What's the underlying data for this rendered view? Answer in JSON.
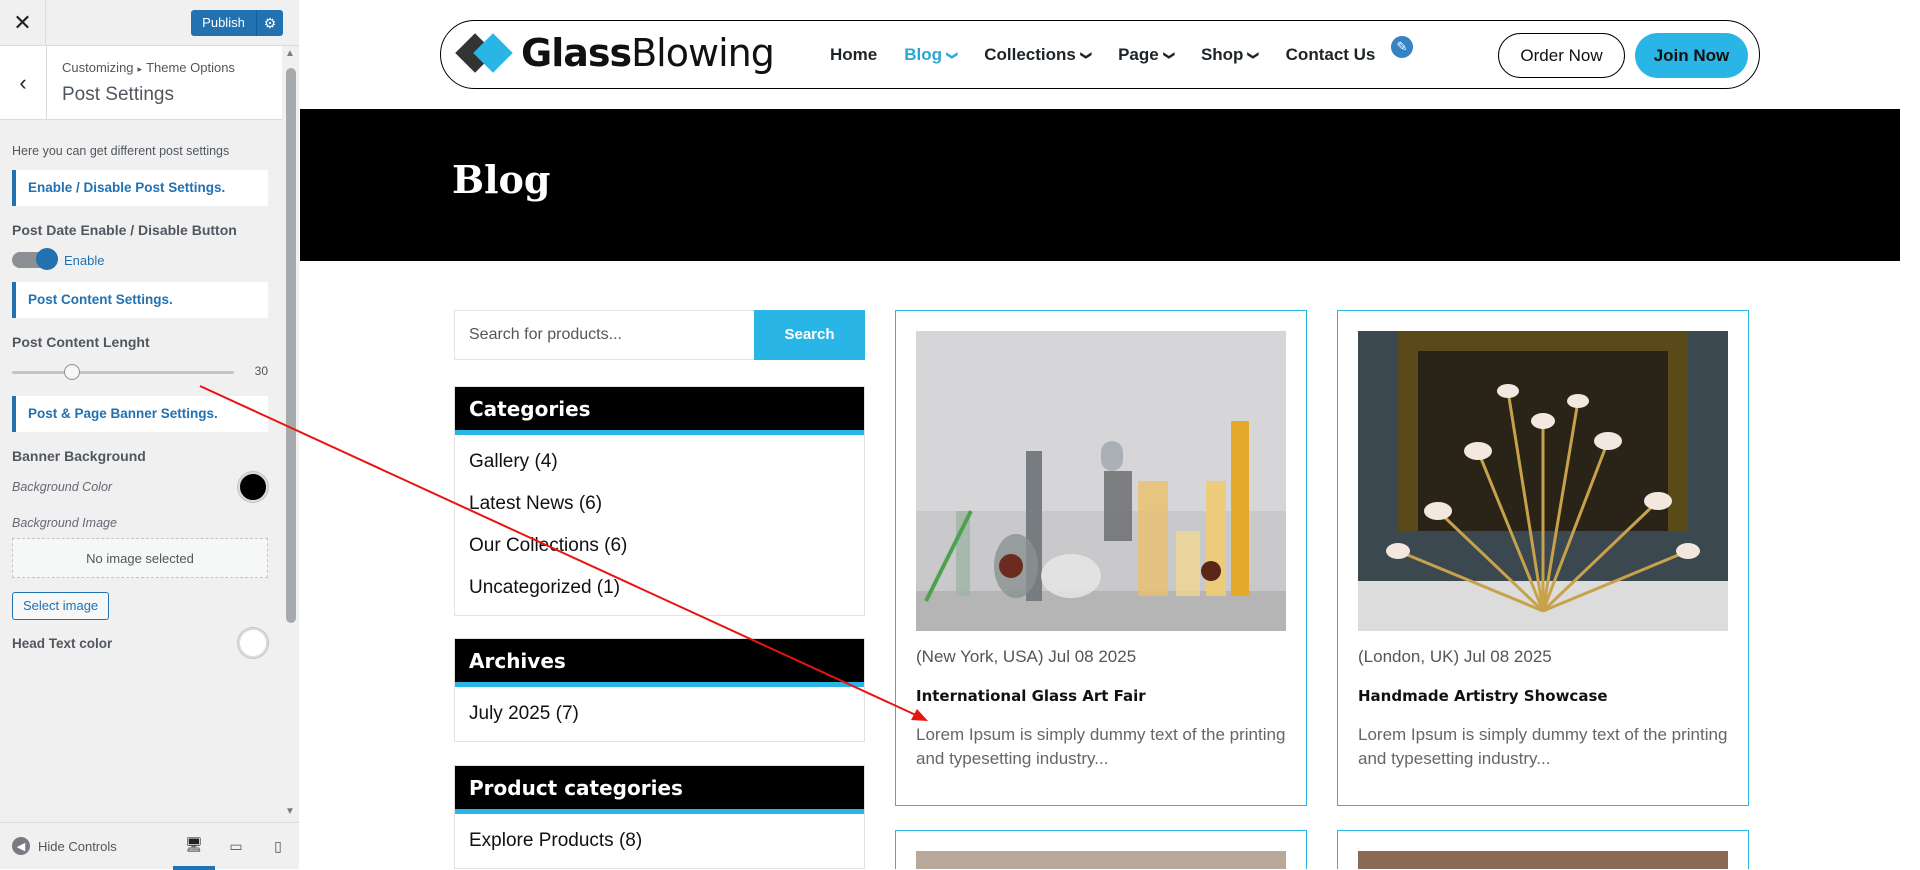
{
  "sidebar": {
    "close_glyph": "✕",
    "publish_label": "Publish",
    "back_glyph": "‹",
    "breadcrumb": {
      "part1": "Customizing",
      "separator": "▸",
      "part2": "Theme Options"
    },
    "panel_title": "Post Settings",
    "description": "Here you can get different post settings",
    "section_enable": "Enable / Disable Post Settings.",
    "post_date_label": "Post Date Enable / Disable Button",
    "post_date_toggle": {
      "label": "Enable",
      "on": true
    },
    "section_content": "Post Content Settings.",
    "content_length_label": "Post Content Lenght",
    "content_length_value": "30",
    "content_length_fraction": 0.27,
    "section_banner": "Post & Page Banner Settings.",
    "banner_bg_label": "Banner Background",
    "bg_color_label": "Background Color",
    "bg_color_value": "#000000",
    "bg_image_label": "Background Image",
    "no_image_text": "No image selected",
    "select_image_label": "Select image",
    "head_text_color_label": "Head Text color",
    "head_text_color_value": "#ffffff",
    "hide_controls_label": "Hide Controls",
    "devices": [
      "desktop-icon",
      "tablet-icon",
      "mobile-icon"
    ]
  },
  "site": {
    "logo_bold": "Glass",
    "logo_regular": "Blowing",
    "nav": [
      {
        "label": "Home",
        "dropdown": false,
        "active": false
      },
      {
        "label": "Blog",
        "dropdown": true,
        "active": true
      },
      {
        "label": "Collections",
        "dropdown": true,
        "active": false
      },
      {
        "label": "Page",
        "dropdown": true,
        "active": false
      },
      {
        "label": "Shop",
        "dropdown": true,
        "active": false
      },
      {
        "label": "Contact Us",
        "dropdown": false,
        "active": false
      }
    ],
    "order_now": "Order Now",
    "join_now": "Join Now",
    "banner_title": "Blog",
    "accent_color": "#29b6e6"
  },
  "search": {
    "placeholder": "Search for products...",
    "button": "Search"
  },
  "widgets": {
    "categories": {
      "title": "Categories",
      "items": [
        "Gallery (4)",
        "Latest News (6)",
        "Our Collections (6)",
        "Uncategorized (1)"
      ]
    },
    "archives": {
      "title": "Archives",
      "items": [
        "July 2025 (7)"
      ]
    },
    "product_categories": {
      "title": "Product categories",
      "items": [
        "Explore Products (8)"
      ]
    }
  },
  "posts": [
    {
      "meta": "(New York, USA)  Jul  08 2025",
      "title": "International Glass Art Fair",
      "excerpt": "Lorem Ipsum is simply dummy text of the printing and typesetting industry..."
    },
    {
      "meta": "(London, UK)  Jul  08 2025",
      "title": "Handmade Artistry Showcase",
      "excerpt": "Lorem Ipsum is simply dummy text of the printing and typesetting industry..."
    }
  ]
}
